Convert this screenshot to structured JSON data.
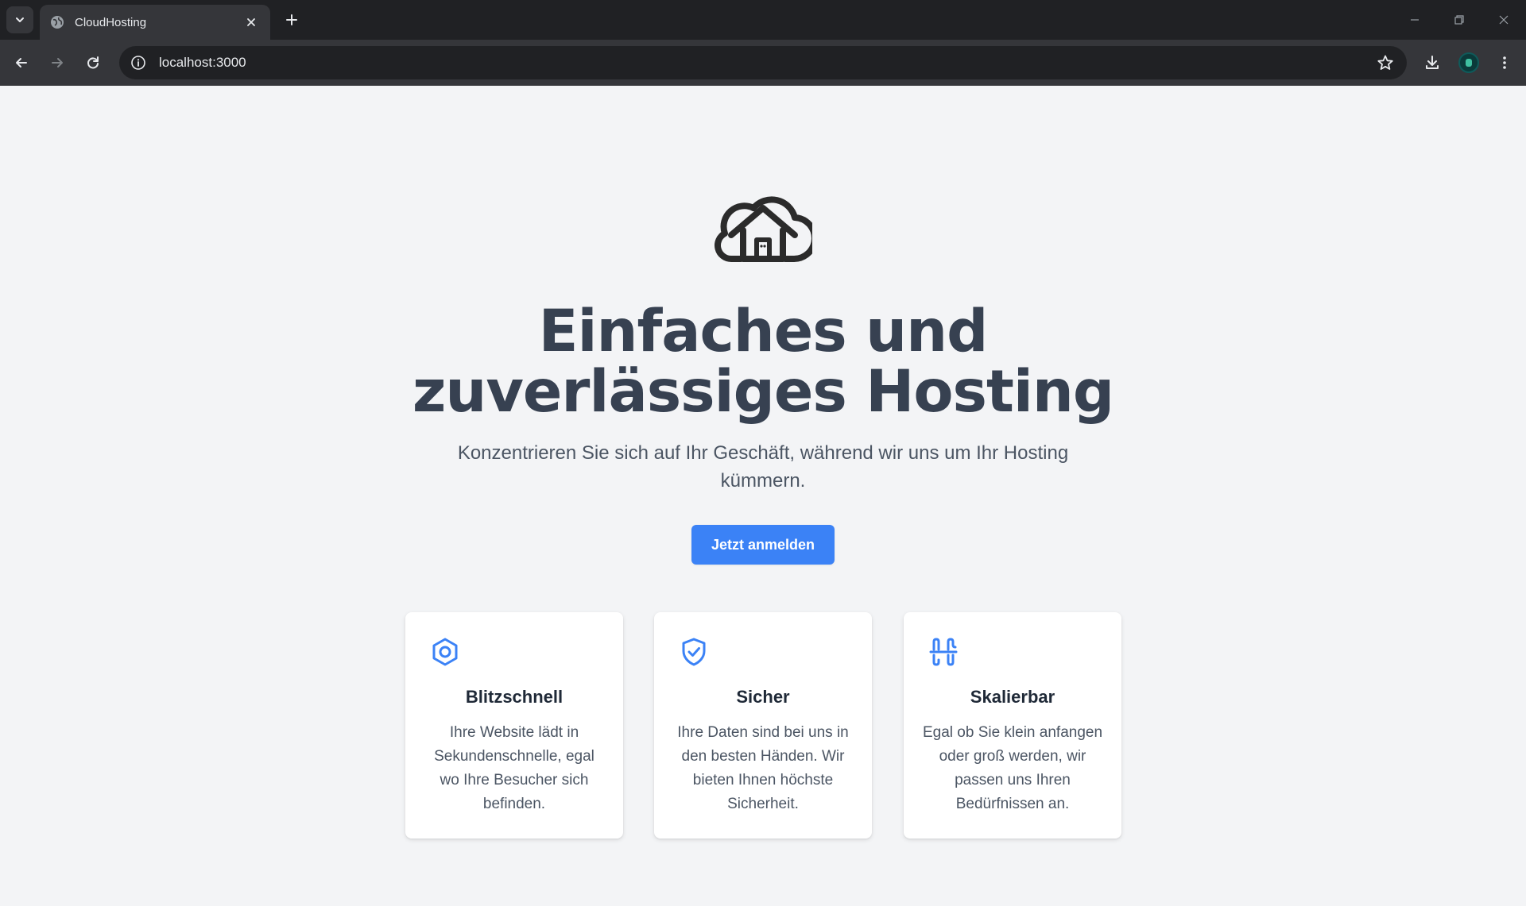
{
  "browser": {
    "tab_title": "CloudHosting",
    "url": "localhost:3000"
  },
  "hero": {
    "title_line1": "Einfaches und",
    "title_line2": "zuverlässiges Hosting",
    "subtitle": "Konzentrieren Sie sich auf Ihr Geschäft, während wir uns um Ihr Hosting kümmern.",
    "cta_label": "Jetzt anmelden"
  },
  "features": [
    {
      "icon": "hexagon-nut-icon",
      "title": "Blitzschnell",
      "text": "Ihre Website lädt in Sekundenschnelle, egal wo Ihre Besucher sich befinden."
    },
    {
      "icon": "shield-check-icon",
      "title": "Sicher",
      "text": "Ihre Daten sind bei uns in den besten Händen. Wir bieten Ihnen höchste Sicherheit."
    },
    {
      "icon": "scale-grid-icon",
      "title": "Skalierbar",
      "text": "Egal ob Sie klein anfangen oder groß werden, wir passen uns Ihren Bedürfnissen an."
    }
  ],
  "colors": {
    "accent": "#3b82f6",
    "heading": "#374151",
    "page_background": "#f3f4f6",
    "browser_frame": "#202124"
  }
}
